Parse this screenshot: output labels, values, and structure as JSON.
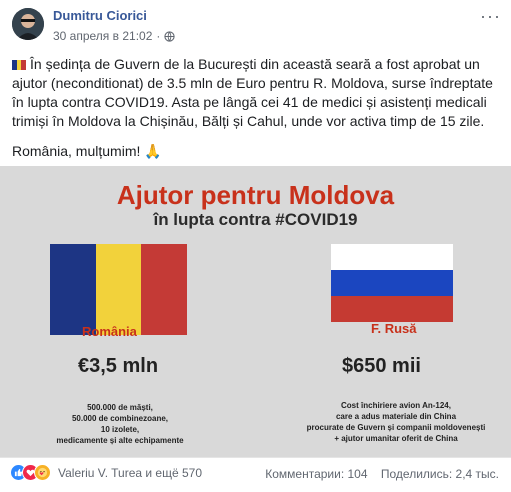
{
  "post": {
    "author": "Dumitru Ciorici",
    "timestamp": "30 апреля в 21:02",
    "separator": "·",
    "more_label": "···",
    "paragraph_1": "În ședința de Guvern de la București din această seară a fost aprobat un ajutor (neconditionat) de 3.5 mln de Euro pentru R. Moldova, surse îndreptate în lupta contra COVID19. Asta pe lângă cei 41 de medici și asistenți medicali trimiși în Moldova la Chișinău, Bălți și Cahul, unde vor activa timp de 15 zile.",
    "paragraph_2": "România, mulțumim!",
    "paragraph_2_emoji": "🙏"
  },
  "image": {
    "title": "Ajutor pentru Moldova",
    "subtitle": "în lupta contra #COVID19",
    "left": {
      "country": "România",
      "amount": "€3,5 mln",
      "note_lines": [
        "500.000 de măști,",
        "50.000 de combinezoane,",
        "10 izolete,",
        "medicamente și alte echipamente"
      ]
    },
    "right": {
      "country": "F. Rusă",
      "amount": "$650 mii",
      "note_lines": [
        "Cost închiriere avion An-124,",
        "care a adus materiale din China",
        "procurate de Guvern și companii moldovenești",
        "+ ajutor umanitar oferit de China"
      ]
    }
  },
  "footer": {
    "reactions_text": "Valeriu V. Turea и ещё 570",
    "comments": "Комментарии: 104",
    "shares": "Поделились: 2,4 тыс."
  },
  "colors": {
    "link": "#385898",
    "accent_red": "#c8311b",
    "ro_blue": "#1d3584",
    "ro_yellow": "#f2d23b",
    "ro_red": "#c43a36",
    "ru_white": "#ffffff",
    "ru_blue": "#1b46c0",
    "ru_red": "#c53a32"
  },
  "icons": [
    "avatar-photo",
    "globe-icon",
    "more-icon",
    "romania-flag-emoji",
    "pray-emoji",
    "like-reaction-icon",
    "love-reaction-icon",
    "care-reaction-icon"
  ]
}
